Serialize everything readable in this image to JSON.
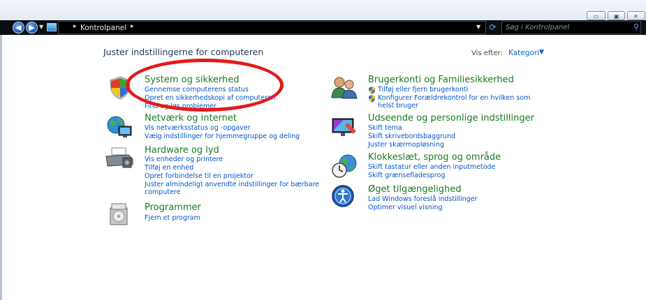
{
  "window": {
    "controls": [
      "minimize",
      "maximize",
      "close"
    ]
  },
  "address": {
    "breadcrumb": "Kontrolpanel",
    "search_placeholder": "Søg i Kontrolpanel"
  },
  "main": {
    "heading": "Juster indstillingerne for computeren",
    "view_by_label": "Vis efter:",
    "view_by_value": "Kategori"
  },
  "left_categories": [
    {
      "title": "System og sikkerhed",
      "icon": "shield-icon",
      "links": [
        "Gennemse computerens status",
        "Opret en sikkerhedskopi af computeren",
        "Find og løs problemer"
      ]
    },
    {
      "title": "Netværk og internet",
      "icon": "network-globe-icon",
      "links": [
        "Vis netværksstatus og -opgaver",
        "Vælg indstillinger for hjemmegruppe og deling"
      ]
    },
    {
      "title": "Hardware og lyd",
      "icon": "printer-icon",
      "links": [
        "Vis enheder og printere",
        "Tilføj en enhed",
        "Opret forbindelse til en projektor",
        "Juster almindeligt anvendte indstillinger for bærbare",
        "computere"
      ]
    },
    {
      "title": "Programmer",
      "icon": "programs-icon",
      "links": [
        "Fjern et program"
      ]
    }
  ],
  "right_categories": [
    {
      "title": "Brugerkonti og Familiesikkerhed",
      "icon": "users-icon",
      "links": [
        "Tilføj eller fjern brugerkonti",
        "Konfigurer Forældrekontrol for en hvilken som",
        "helst bruger"
      ]
    },
    {
      "title": "Udseende og personlige indstillinger",
      "icon": "appearance-icon",
      "links": [
        "Skift tema",
        "Skift skrivebordsbaggrund",
        "Juster skærmopløsning"
      ]
    },
    {
      "title": "Klokkeslæt, sprog og område",
      "icon": "clock-globe-icon",
      "links": [
        "Skift tastatur eller anden inputmetode",
        "Skift grænsefladesprog"
      ]
    },
    {
      "title": "Øget tilgængelighed",
      "icon": "accessibility-icon",
      "links": [
        "Lad Windows foreslå indstillinger",
        "Optimer visuel visning"
      ]
    }
  ],
  "colors": {
    "category_title": "#1a7a22",
    "link": "#0055cc",
    "annotation_circle": "#e51919"
  }
}
